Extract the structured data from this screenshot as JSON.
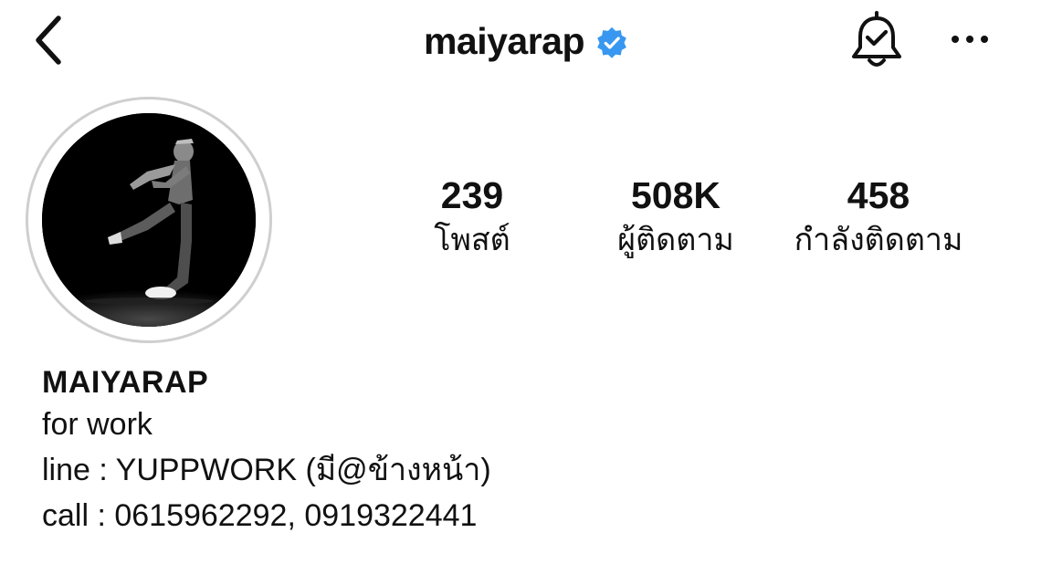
{
  "header": {
    "username": "maiyarap",
    "verified": true,
    "icons": {
      "back": "chevron-left-icon",
      "verified": "verified-badge-icon",
      "notifications": "bell-check-icon",
      "more": "more-horizontal-icon"
    },
    "accent_color": "#3897f0"
  },
  "profile": {
    "avatar": "profile-photo (dancer, black & white)"
  },
  "stats": {
    "posts": {
      "value": "239",
      "label": "โพสต์"
    },
    "followers": {
      "value": "508K",
      "label": "ผู้ติดตาม"
    },
    "following": {
      "value": "458",
      "label": "กำลังติดตาม"
    }
  },
  "bio": {
    "name": "MAIYARAP",
    "lines": [
      "for work",
      "line : YUPPWORK (มี@ข้างหน้า)",
      "call : 0615962292, 0919322441"
    ]
  }
}
